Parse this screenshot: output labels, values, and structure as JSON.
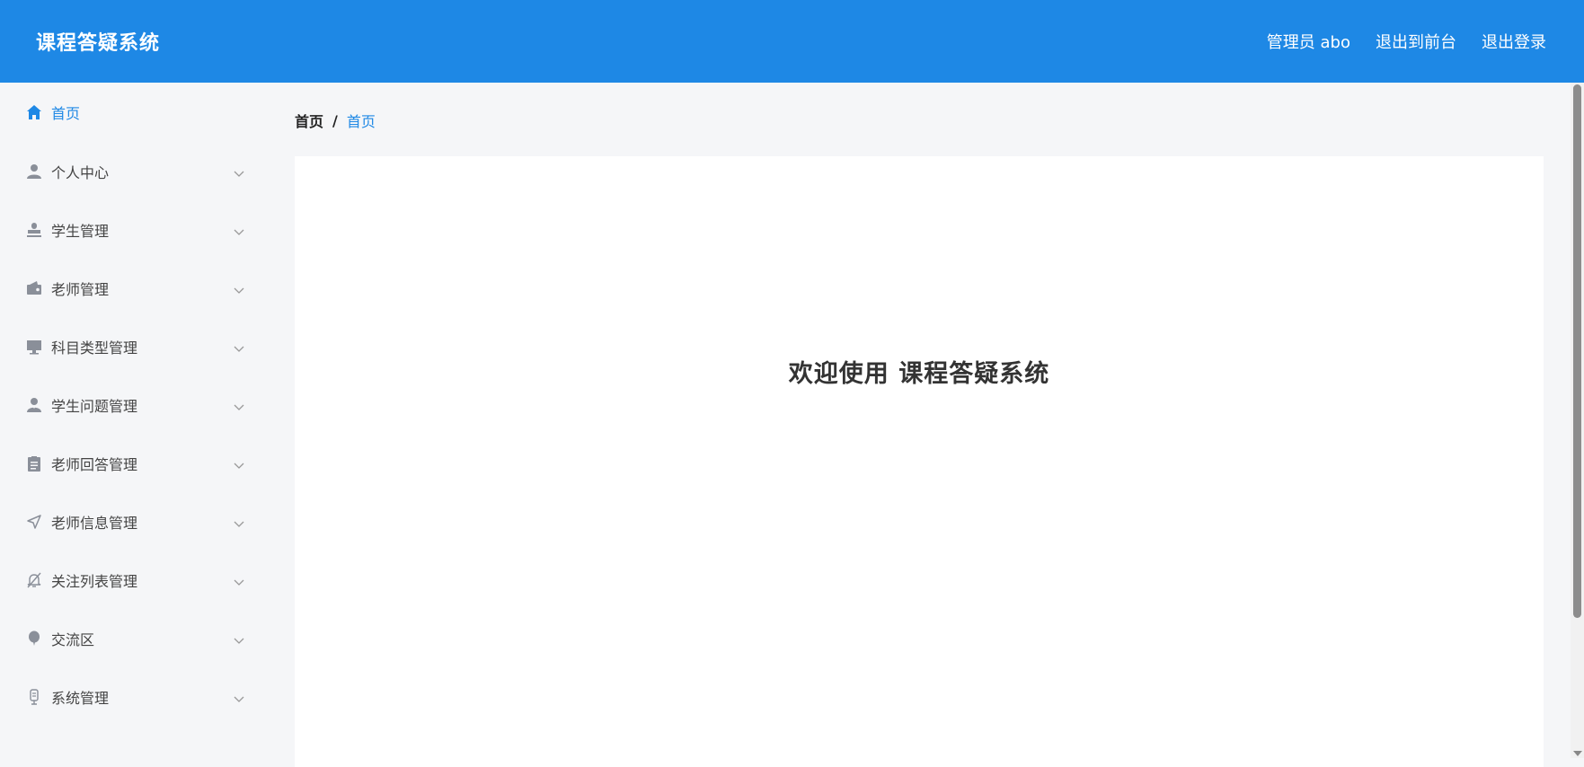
{
  "header": {
    "title": "课程答疑系统",
    "user": "管理员 abo",
    "to_frontend": "退出到前台",
    "logout": "退出登录",
    "bg_color": "#1e88e5"
  },
  "sidebar": {
    "items": [
      {
        "label": "首页",
        "icon": "home-icon",
        "active": true
      },
      {
        "label": "个人中心",
        "icon": "user-icon"
      },
      {
        "label": "学生管理",
        "icon": "stamp-icon"
      },
      {
        "label": "老师管理",
        "icon": "wallet-icon"
      },
      {
        "label": "科目类型管理",
        "icon": "monitor-icon"
      },
      {
        "label": "学生问题管理",
        "icon": "user-avatar-icon"
      },
      {
        "label": "老师回答管理",
        "icon": "clipboard-icon"
      },
      {
        "label": "老师信息管理",
        "icon": "send-icon"
      },
      {
        "label": "关注列表管理",
        "icon": "bell-off-icon"
      },
      {
        "label": "交流区",
        "icon": "balloon-icon"
      },
      {
        "label": "系统管理",
        "icon": "microphone-icon"
      }
    ]
  },
  "breadcrumb": {
    "root": "首页",
    "separator": "/",
    "current": "首页"
  },
  "main": {
    "welcome": "欢迎使用 课程答疑系统"
  },
  "colors": {
    "accent": "#1e88e5",
    "icon_gray": "#8a8f99"
  }
}
